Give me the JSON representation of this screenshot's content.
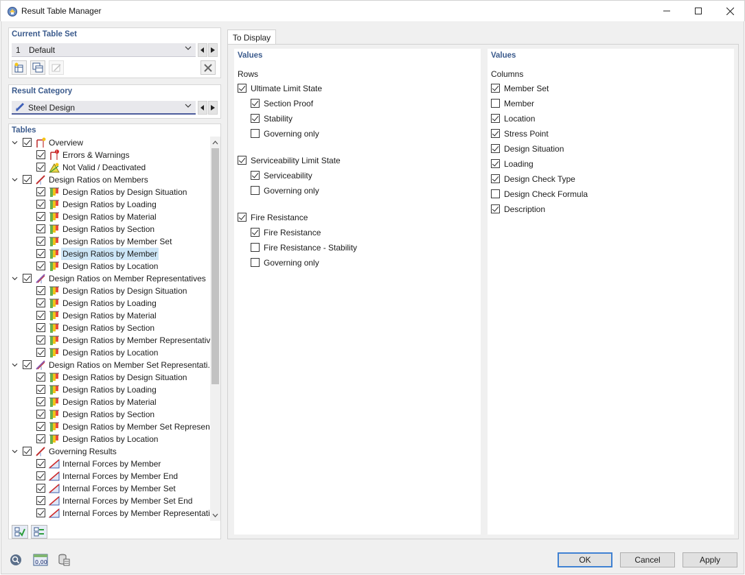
{
  "window": {
    "title": "Result Table Manager",
    "min_icon": "minimize-icon",
    "max_icon": "maximize-icon",
    "close_icon": "close-icon"
  },
  "current_table_set": {
    "title": "Current Table Set",
    "number": "1",
    "value": "Default"
  },
  "result_category": {
    "title": "Result Category",
    "value": "Steel Design"
  },
  "tables": {
    "title": "Tables",
    "rows": [
      {
        "label": "Overview",
        "level": 0,
        "icon": "overview"
      },
      {
        "label": "Errors & Warnings",
        "level": 1,
        "icon": "errors"
      },
      {
        "label": "Not Valid / Deactivated",
        "level": 1,
        "icon": "notvalid"
      },
      {
        "label": "Design Ratios on Members",
        "level": 0,
        "icon": "member"
      },
      {
        "label": "Design Ratios by Design Situation",
        "level": 1,
        "icon": "ratio"
      },
      {
        "label": "Design Ratios by Loading",
        "level": 1,
        "icon": "ratio"
      },
      {
        "label": "Design Ratios by Material",
        "level": 1,
        "icon": "ratio"
      },
      {
        "label": "Design Ratios by Section",
        "level": 1,
        "icon": "ratio"
      },
      {
        "label": "Design Ratios by Member Set",
        "level": 1,
        "icon": "ratio"
      },
      {
        "label": "Design Ratios by Member",
        "level": 1,
        "icon": "ratio",
        "selected": true
      },
      {
        "label": "Design Ratios by Location",
        "level": 1,
        "icon": "ratio"
      },
      {
        "label": "Design Ratios on Member Representatives",
        "level": 0,
        "icon": "memberrep"
      },
      {
        "label": "Design Ratios by Design Situation",
        "level": 1,
        "icon": "ratio"
      },
      {
        "label": "Design Ratios by Loading",
        "level": 1,
        "icon": "ratio"
      },
      {
        "label": "Design Ratios by Material",
        "level": 1,
        "icon": "ratio"
      },
      {
        "label": "Design Ratios by Section",
        "level": 1,
        "icon": "ratio"
      },
      {
        "label": "Design Ratios by Member Representative",
        "level": 1,
        "icon": "ratio"
      },
      {
        "label": "Design Ratios by Location",
        "level": 1,
        "icon": "ratio"
      },
      {
        "label": "Design Ratios on Member Set Representati...",
        "level": 0,
        "icon": "memberrep"
      },
      {
        "label": "Design Ratios by Design Situation",
        "level": 1,
        "icon": "ratio"
      },
      {
        "label": "Design Ratios by Loading",
        "level": 1,
        "icon": "ratio"
      },
      {
        "label": "Design Ratios by Material",
        "level": 1,
        "icon": "ratio"
      },
      {
        "label": "Design Ratios by Section",
        "level": 1,
        "icon": "ratio"
      },
      {
        "label": "Design Ratios by Member Set Represen...",
        "level": 1,
        "icon": "ratio"
      },
      {
        "label": "Design Ratios by Location",
        "level": 1,
        "icon": "ratio"
      },
      {
        "label": "Governing Results",
        "level": 0,
        "icon": "member"
      },
      {
        "label": "Internal Forces by Member",
        "level": 1,
        "icon": "forces"
      },
      {
        "label": "Internal Forces by Member End",
        "level": 1,
        "icon": "forces"
      },
      {
        "label": "Internal Forces by Member Set",
        "level": 1,
        "icon": "forces"
      },
      {
        "label": "Internal Forces by Member Set End",
        "level": 1,
        "icon": "forces"
      },
      {
        "label": "Internal Forces by Member Representati...",
        "level": 1,
        "icon": "forces"
      }
    ]
  },
  "tab": {
    "label": "To Display"
  },
  "rows_panel": {
    "title": "Values",
    "subtitle": "Rows",
    "options": [
      {
        "label": "Ultimate Limit State",
        "checked": true,
        "indent": 0
      },
      {
        "label": "Section Proof",
        "checked": true,
        "indent": 1
      },
      {
        "label": "Stability",
        "checked": true,
        "indent": 1
      },
      {
        "label": "Governing only",
        "checked": false,
        "indent": 1
      },
      {
        "label": "Serviceability Limit State",
        "checked": true,
        "indent": 0
      },
      {
        "label": "Serviceability",
        "checked": true,
        "indent": 1
      },
      {
        "label": "Governing only",
        "checked": false,
        "indent": 1
      },
      {
        "label": "Fire Resistance",
        "checked": true,
        "indent": 0
      },
      {
        "label": "Fire Resistance",
        "checked": true,
        "indent": 1
      },
      {
        "label": "Fire Resistance - Stability",
        "checked": false,
        "indent": 1
      },
      {
        "label": "Governing only",
        "checked": false,
        "indent": 1
      }
    ]
  },
  "columns_panel": {
    "title": "Values",
    "subtitle": "Columns",
    "options": [
      {
        "label": "Member Set",
        "checked": true
      },
      {
        "label": "Member",
        "checked": false
      },
      {
        "label": "Location",
        "checked": true
      },
      {
        "label": "Stress Point",
        "checked": true
      },
      {
        "label": "Design Situation",
        "checked": true
      },
      {
        "label": "Loading",
        "checked": true
      },
      {
        "label": "Design Check Type",
        "checked": true
      },
      {
        "label": "Design Check Formula",
        "checked": false
      },
      {
        "label": "Description",
        "checked": true
      }
    ]
  },
  "buttons": {
    "ok": "OK",
    "cancel": "Cancel",
    "apply": "Apply"
  },
  "bottom_icon_text": "0,00"
}
